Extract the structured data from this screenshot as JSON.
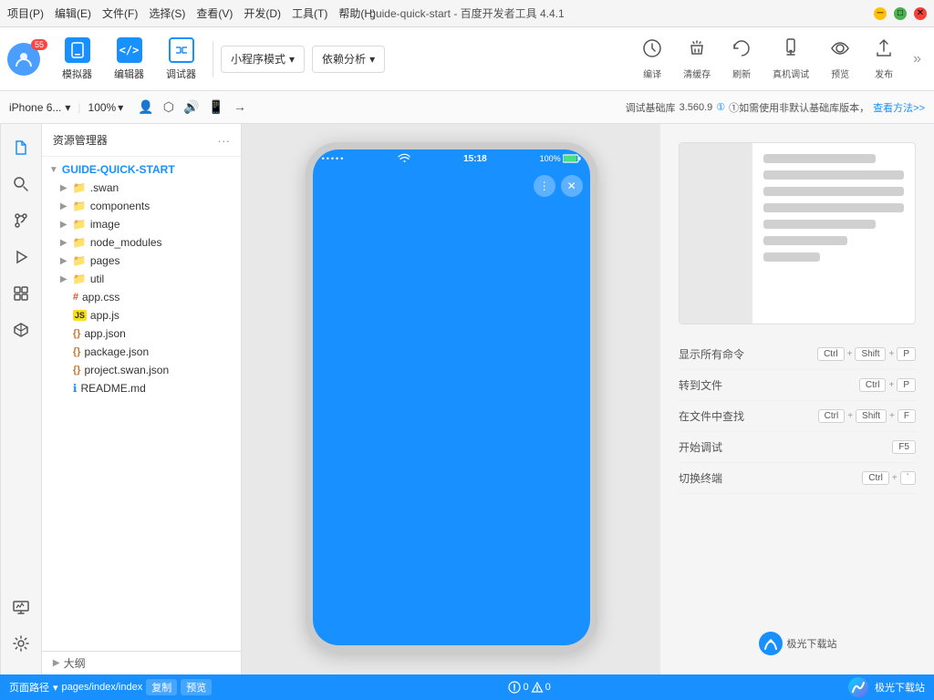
{
  "titlebar": {
    "menus": [
      "项目(P)",
      "编辑(E)",
      "文件(F)",
      "选择(S)",
      "查看(V)",
      "开发(D)",
      "工具(T)",
      "帮助(H)"
    ],
    "title": "guide-quick-start - 百度开发者工具 4.4.1",
    "controls": {
      "min": "─",
      "max": "□",
      "close": "✕"
    }
  },
  "toolbar": {
    "avatar_badge": "55",
    "buttons": [
      {
        "id": "simulator",
        "icon": "📱",
        "label": "模拟器"
      },
      {
        "id": "editor",
        "icon": "</>",
        "label": "编辑器"
      },
      {
        "id": "debugger",
        "icon": "⇄",
        "label": "调试器"
      }
    ],
    "mode_selector": "小程序模式",
    "analysis": "依赖分析",
    "actions": [
      {
        "id": "compile",
        "label": "编译"
      },
      {
        "id": "clear-cache",
        "label": "清缓存"
      },
      {
        "id": "refresh",
        "label": "刷新"
      },
      {
        "id": "real-device",
        "label": "真机调试"
      },
      {
        "id": "preview",
        "label": "预览"
      },
      {
        "id": "publish",
        "label": "发布"
      }
    ],
    "more": "»"
  },
  "subtoolbar": {
    "device": "iPhone 6...",
    "zoom": "100%",
    "lib_label": "调试基础库",
    "lib_version": "3.560.9",
    "lib_hint": "①如需使用非默认基础库版本，",
    "lib_link": "查看方法>>"
  },
  "iconsidebar": {
    "items": [
      {
        "id": "files",
        "icon": "📄"
      },
      {
        "id": "search",
        "icon": "🔍"
      },
      {
        "id": "git",
        "icon": "⎇"
      },
      {
        "id": "debug",
        "icon": "🐛"
      },
      {
        "id": "extensions",
        "icon": "⊞"
      },
      {
        "id": "3d",
        "icon": "◉"
      }
    ],
    "bottom": {
      "id": "monitor",
      "icon": "📊"
    },
    "settings": {
      "id": "settings",
      "icon": "⚙"
    }
  },
  "filetree": {
    "header": "资源管理器",
    "more_icon": "···",
    "root": "GUIDE-QUICK-START",
    "items": [
      {
        "name": ".swan",
        "type": "folder",
        "level": 1
      },
      {
        "name": "components",
        "type": "folder",
        "level": 1
      },
      {
        "name": "image",
        "type": "folder",
        "level": 1
      },
      {
        "name": "node_modules",
        "type": "folder",
        "level": 1
      },
      {
        "name": "pages",
        "type": "folder",
        "level": 1
      },
      {
        "name": "util",
        "type": "folder",
        "level": 1
      },
      {
        "name": "app.css",
        "type": "css",
        "level": 1,
        "icon": "#"
      },
      {
        "name": "app.js",
        "type": "js",
        "level": 1,
        "icon": "JS"
      },
      {
        "name": "app.json",
        "type": "json",
        "level": 1,
        "icon": "{}"
      },
      {
        "name": "package.json",
        "type": "json",
        "level": 1,
        "icon": "{}"
      },
      {
        "name": "project.swan.json",
        "type": "json",
        "level": 1,
        "icon": "{}"
      },
      {
        "name": "README.md",
        "type": "info",
        "level": 1,
        "icon": "ℹ"
      }
    ]
  },
  "simulator": {
    "device": "iPhone 6",
    "status_bar": {
      "dots": "•••••",
      "wifi": "wifi",
      "time": "15:18",
      "battery": "100%"
    }
  },
  "rightpanel": {
    "shortcuts": [
      {
        "name": "显示所有命令",
        "keys": [
          "Ctrl",
          "+",
          "Shift",
          "+",
          "P"
        ]
      },
      {
        "name": "转到文件",
        "keys": [
          "Ctrl",
          "+",
          "P"
        ]
      },
      {
        "name": "在文件中查找",
        "keys": [
          "Ctrl",
          "+",
          "Shift",
          "+",
          "F"
        ]
      },
      {
        "name": "开始调试",
        "keys": [
          "F5"
        ]
      },
      {
        "name": "切换终端",
        "keys": [
          "Ctrl",
          "+",
          "`"
        ]
      }
    ]
  },
  "bottombar": {
    "path_label": "页面路径",
    "path_value": "pages/index/index",
    "copy_btn": "复制",
    "preview_btn": "预览",
    "status": "⊗ 0 ⚠ 0",
    "logo": "极光下载站"
  },
  "outline": {
    "label": "大纲"
  }
}
